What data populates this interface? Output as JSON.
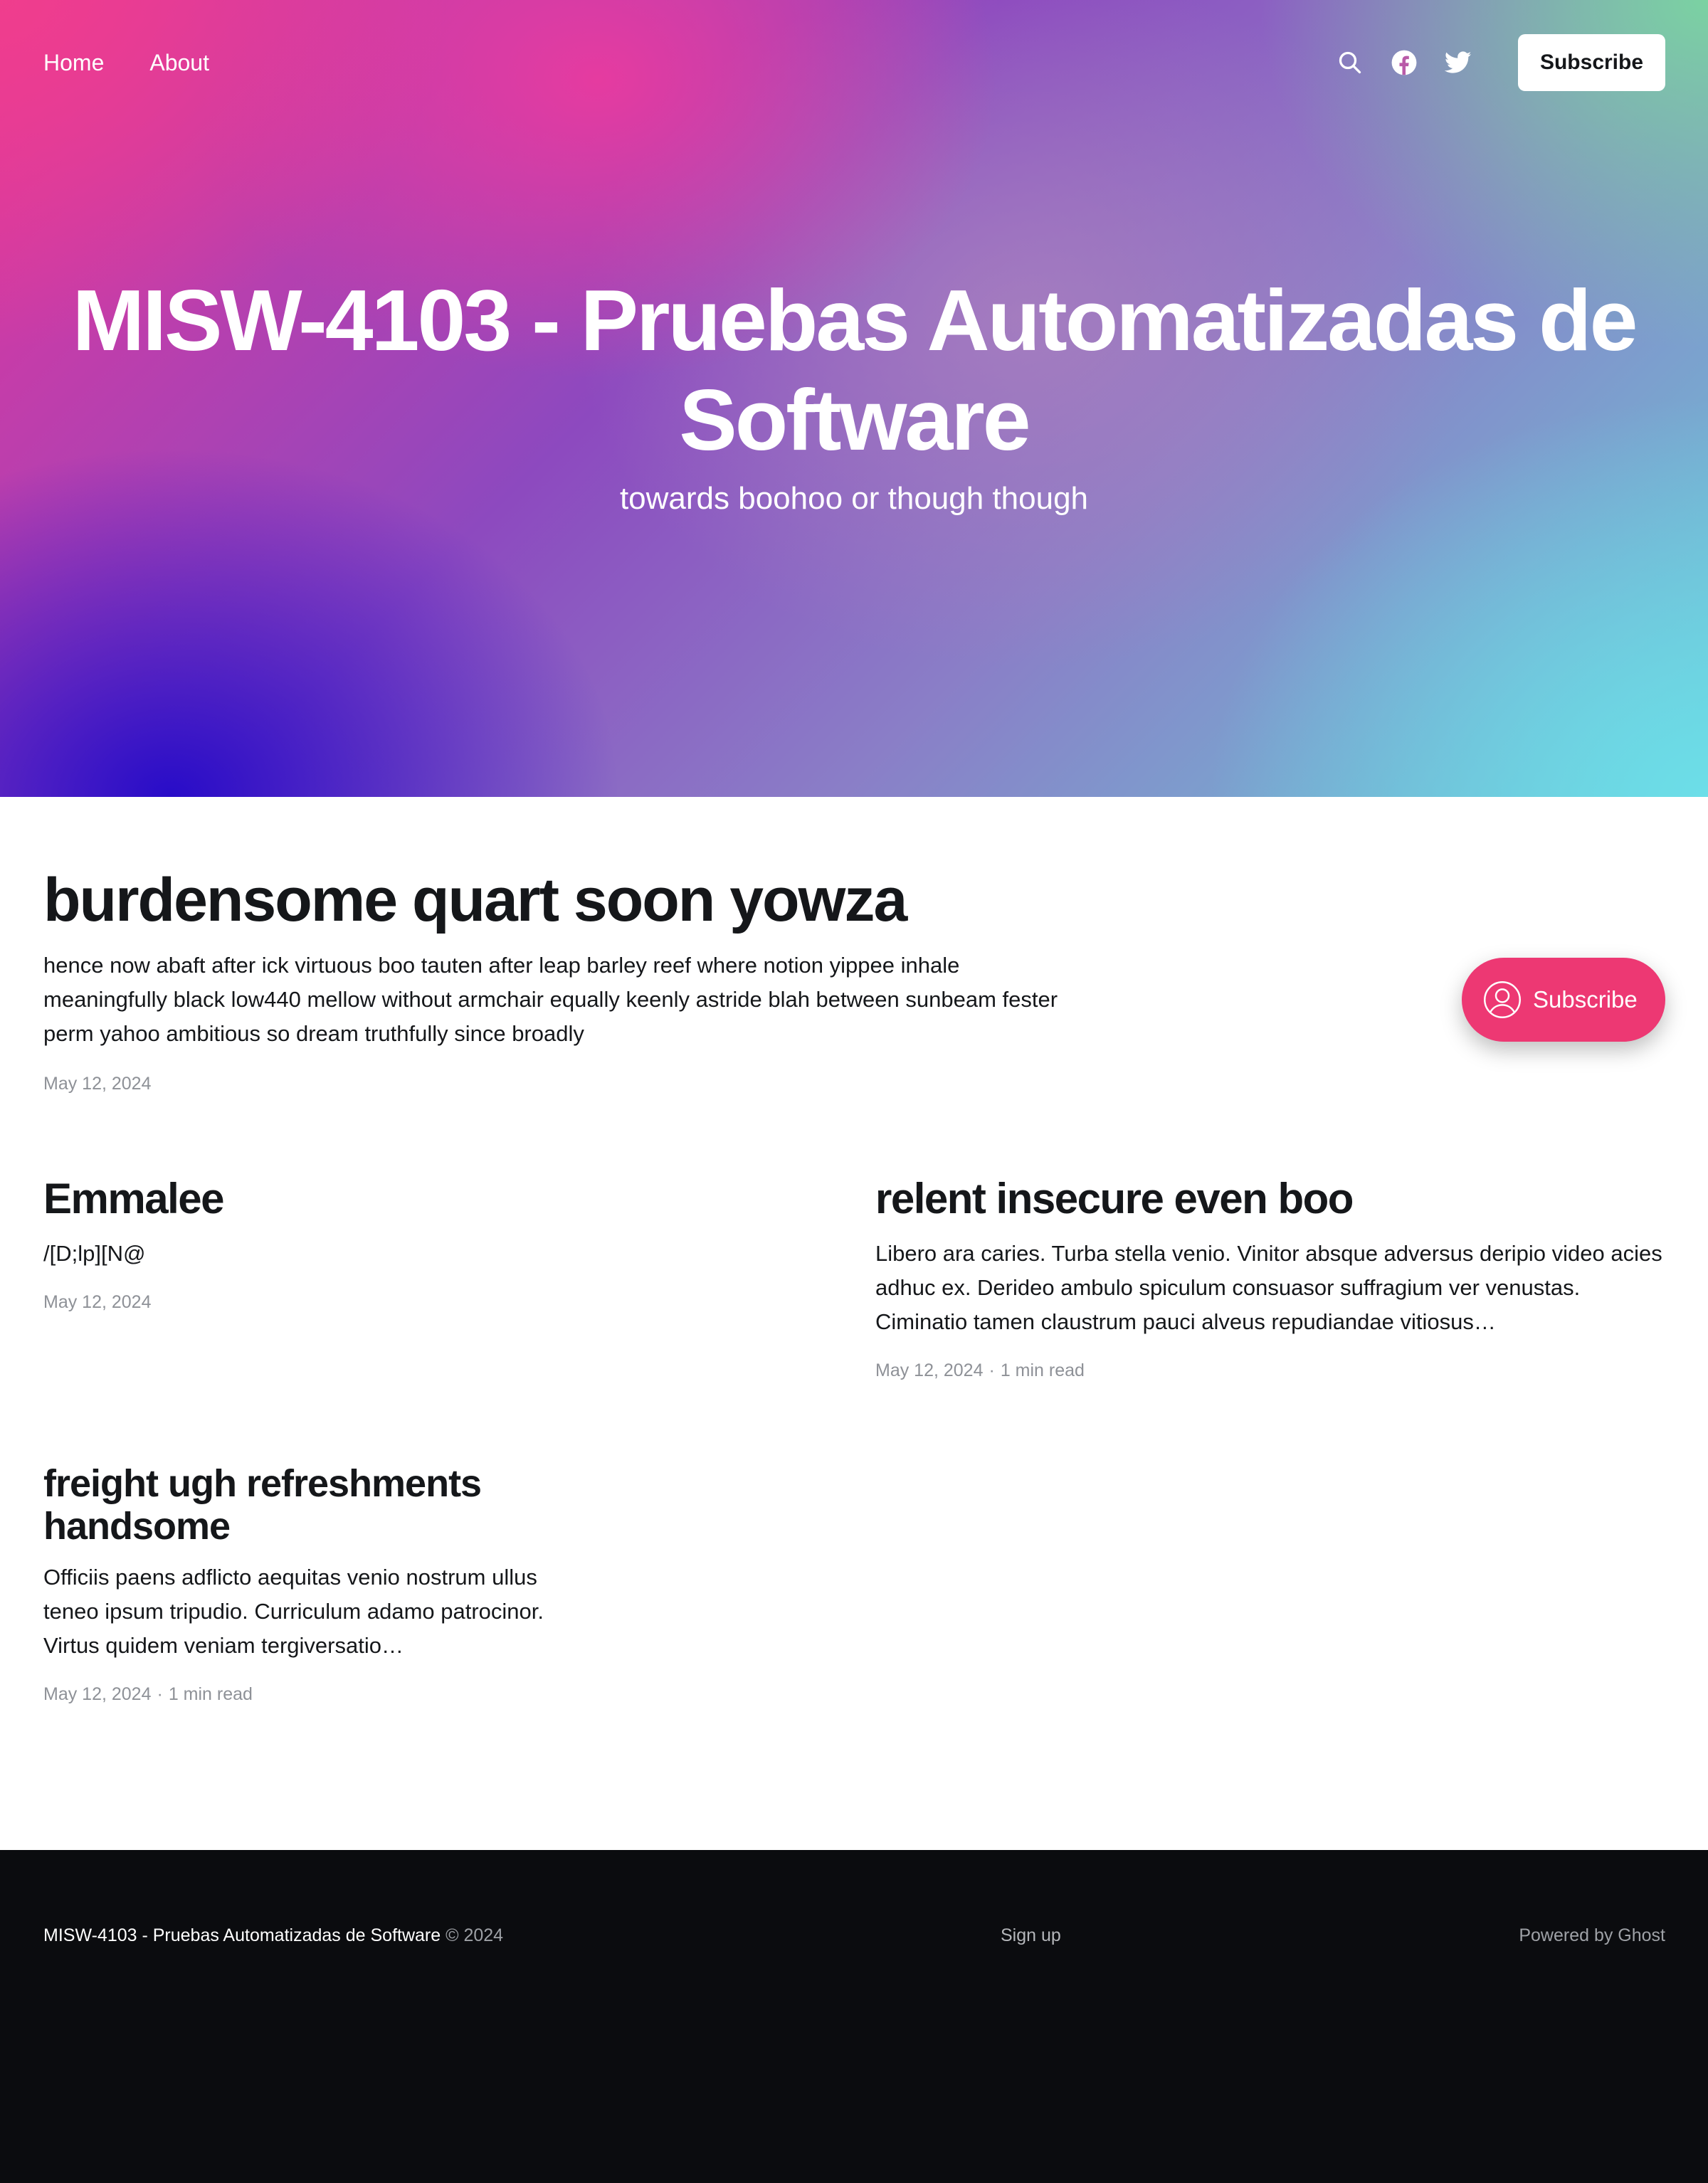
{
  "nav": {
    "links": [
      {
        "label": "Home"
      },
      {
        "label": "About"
      }
    ],
    "icons": [
      "search-icon",
      "facebook-icon",
      "twitter-icon"
    ],
    "subscribe_label": "Subscribe"
  },
  "hero": {
    "title": "MISW-4103 - Pruebas Automatizadas de Software",
    "description": "towards boohoo or though though"
  },
  "posts": [
    {
      "title": "burdensome quart soon yowza",
      "excerpt": "hence now abaft after ick virtuous boo tauten after leap barley reef where notion yippee inhale meaningfully black low440 mellow without armchair equally keenly astride blah between sunbeam fester perm yahoo ambitious so dream truthfully since broadly",
      "date": "May 12, 2024",
      "read_time": ""
    },
    {
      "title": "Emmalee",
      "excerpt": "/[D;lp][N@",
      "date": "May 12, 2024",
      "read_time": ""
    },
    {
      "title": "relent insecure even boo",
      "excerpt": "Libero ara caries. Turba stella venio. Vinitor absque adversus deripio video acies adhuc ex. Derideo ambulo spiculum consuasor suffragium ver venustas. Ciminatio tamen claustrum pauci alveus repudiandae vitiosus…",
      "date": "May 12, 2024",
      "read_time": "1 min read"
    },
    {
      "title": "freight ugh refreshments handsome",
      "excerpt": "Officiis paens adflicto aequitas venio nostrum ullus teneo ipsum tripudio. Curriculum adamo patrocinor. Virtus quidem veniam tergiversatio…",
      "date": "May 12, 2024",
      "read_time": "1 min read"
    }
  ],
  "floating_subscribe": {
    "label": "Subscribe",
    "icon": "user-circle-icon"
  },
  "footer": {
    "site_name": "MISW-4103 - Pruebas Automatizadas de Software",
    "copyright": "© 2024",
    "signup_label": "Sign up",
    "powered_by": "Powered by Ghost"
  },
  "colors": {
    "accent": "#ed3873",
    "footer_bg": "#0b0c0f",
    "text": "#15171a",
    "meta": "#8e9197"
  }
}
